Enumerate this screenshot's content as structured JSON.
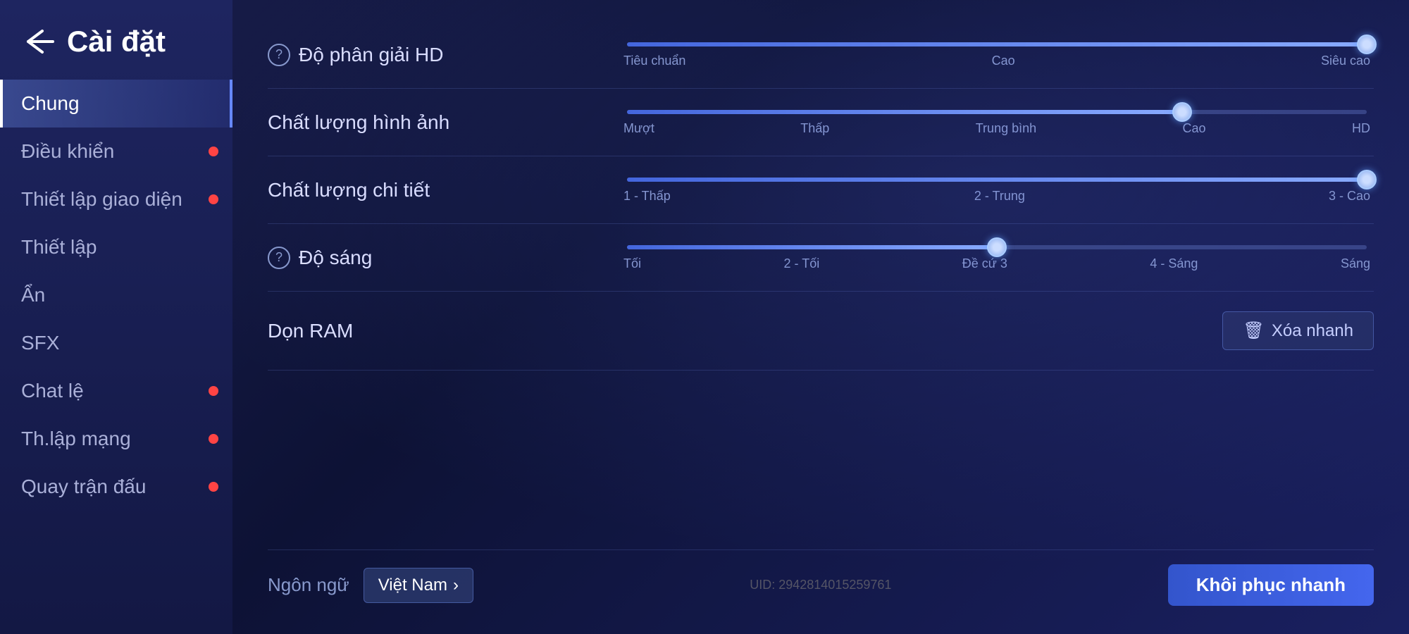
{
  "sidebar": {
    "title": "Cài đặt",
    "back_icon": "←",
    "items": [
      {
        "id": "chung",
        "label": "Chung",
        "active": true,
        "dot": false
      },
      {
        "id": "dieu-khien",
        "label": "Điều khiển",
        "active": false,
        "dot": true
      },
      {
        "id": "thiet-lap-giao-dien",
        "label": "Thiết lập giao diện",
        "active": false,
        "dot": true
      },
      {
        "id": "thiet-lap",
        "label": "Thiết lập",
        "active": false,
        "dot": false
      },
      {
        "id": "an",
        "label": "Ẩn",
        "active": false,
        "dot": false
      },
      {
        "id": "sfx",
        "label": "SFX",
        "active": false,
        "dot": false
      },
      {
        "id": "chat-le",
        "label": "Chat lệ",
        "active": false,
        "dot": true
      },
      {
        "id": "th-lap-mang",
        "label": "Th.lập mạng",
        "active": false,
        "dot": true
      },
      {
        "id": "quay-tran-dau",
        "label": "Quay trận đấu",
        "active": false,
        "dot": true
      }
    ]
  },
  "settings": {
    "items": [
      {
        "id": "do-phan-giai-hd",
        "label": "Độ phân giải HD",
        "has_help": true,
        "type": "slider",
        "value_pct": 100,
        "thumb_pct": 100,
        "labels": [
          "Tiêu chuẩn",
          "Cao",
          "Siêu cao"
        ]
      },
      {
        "id": "chat-luong-hinh-anh",
        "label": "Chất lượng hình ảnh",
        "has_help": false,
        "type": "slider",
        "value_pct": 75,
        "thumb_pct": 75,
        "labels": [
          "Mượt",
          "Thấp",
          "Trung bình",
          "Cao",
          "HD"
        ]
      },
      {
        "id": "chat-luong-chi-tiet",
        "label": "Chất lượng chi tiết",
        "has_help": false,
        "type": "slider",
        "value_pct": 100,
        "thumb_pct": 100,
        "labels": [
          "1 - Thấp",
          "2 - Trung",
          "3 - Cao"
        ]
      },
      {
        "id": "do-sang",
        "label": "Độ sáng",
        "has_help": true,
        "type": "slider",
        "value_pct": 50,
        "thumb_pct": 50,
        "labels": [
          "Tối",
          "2 - Tối",
          "Đề cứ 3",
          "4 - Sáng",
          "Sáng"
        ]
      },
      {
        "id": "don-ram",
        "label": "Dọn RAM",
        "has_help": false,
        "type": "button",
        "button_label": "Xóa nhanh",
        "button_icon": "🗑"
      }
    ]
  },
  "bottom": {
    "lang_label": "Ngôn ngữ",
    "lang_value": "Việt Nam",
    "lang_arrow": "›",
    "uid": "UID: 2942814015259761",
    "restore_label": "Khôi phục nhanh"
  }
}
